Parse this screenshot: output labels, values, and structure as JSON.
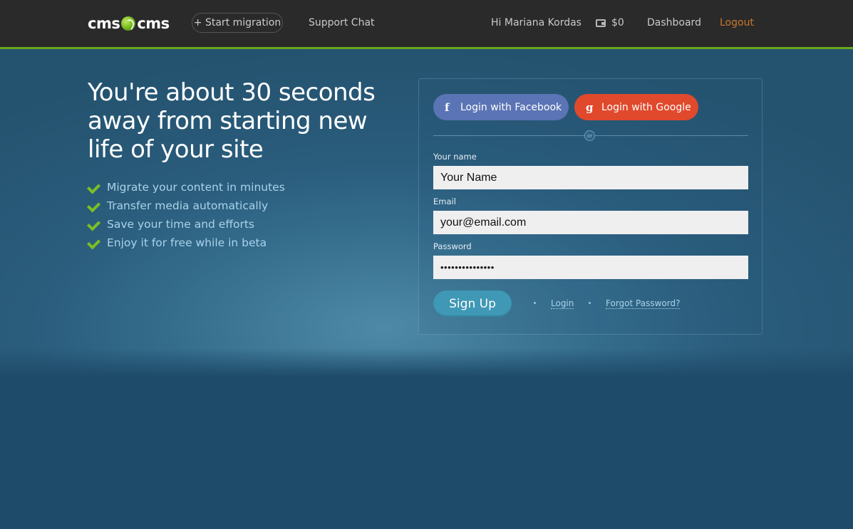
{
  "header": {
    "logo_left": "cms",
    "logo_right": "cms",
    "start_migration": "+ Start migration",
    "support_chat": "Support Chat",
    "greeting": "Hi Mariana Kordas",
    "balance": "$0",
    "dashboard": "Dashboard",
    "logout": "Logout"
  },
  "hero": {
    "headline": "You're about 30 seconds away from starting new life of your site",
    "features": [
      "Migrate your content in minutes",
      "Transfer media automatically",
      "Save your time and efforts",
      "Enjoy it for free while in beta"
    ]
  },
  "form": {
    "facebook_label": "Login with Facebook",
    "google_label": "Login with Google",
    "facebook_glyph": "f",
    "google_glyph": "g",
    "or_text": "or",
    "name_label": "Your name",
    "name_value": "Your Name",
    "email_label": "Email",
    "email_value": "your@email.com",
    "password_label": "Password",
    "password_value": "•••••••••••••••",
    "signup_label": "Sign Up",
    "login_link": "Login",
    "forgot_link": "Forgot Password?"
  },
  "colors": {
    "accent_green": "#6aa51c",
    "logout_orange": "#c8782a",
    "facebook_blue": "#5b74b5",
    "google_red": "#e0492c",
    "signup_blue": "#3f98b5",
    "page_background": "#1f4b6a"
  }
}
